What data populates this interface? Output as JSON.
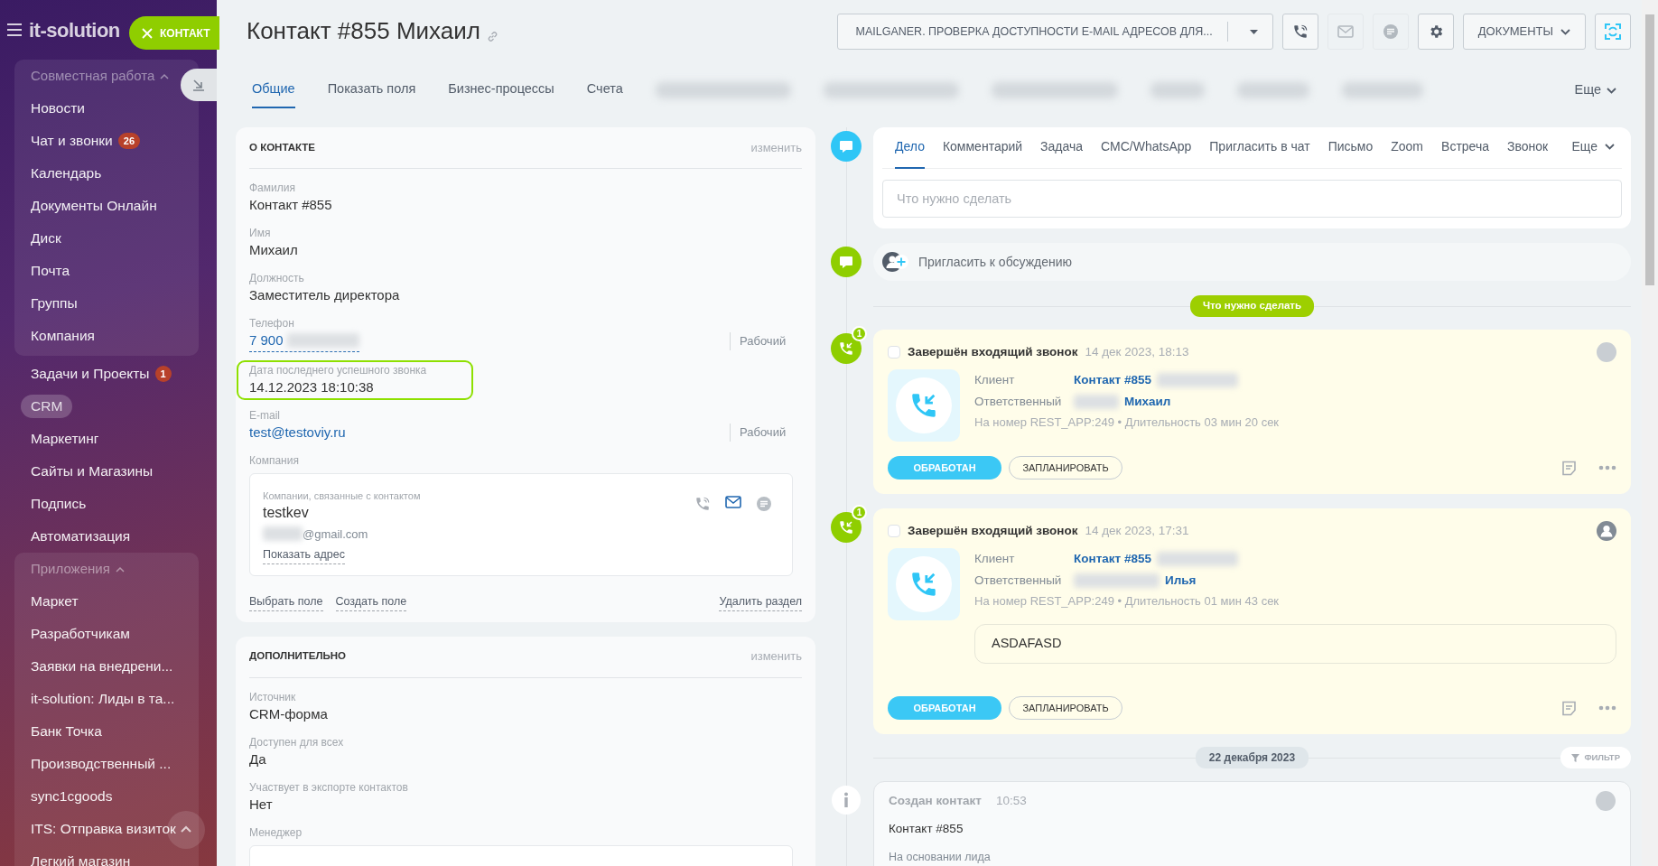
{
  "slider_label": "КОНТАКТ",
  "sidebar": {
    "logo": "it-solution",
    "entries": [
      {
        "kind": "group",
        "title": "Совместная работа",
        "expanded": true,
        "children": [
          {
            "label": "Новости",
            "selected": false
          },
          {
            "label": "Чат и звонки",
            "badge": "26",
            "selected": false
          },
          {
            "label": "Календарь",
            "selected": false
          },
          {
            "label": "Документы Онлайн",
            "selected": false
          },
          {
            "label": "Диск",
            "selected": false
          },
          {
            "label": "Почта",
            "selected": false
          },
          {
            "label": "Группы",
            "selected": false
          },
          {
            "label": "Компания",
            "selected": false
          }
        ]
      },
      {
        "kind": "item",
        "label": "Задачи и Проекты",
        "badge": "1",
        "selected": false
      },
      {
        "kind": "item",
        "label": "CRM",
        "selected": true
      },
      {
        "kind": "item",
        "label": "Маркетинг",
        "selected": false
      },
      {
        "kind": "item",
        "label": "Сайты и Магазины",
        "selected": false
      },
      {
        "kind": "item",
        "label": "Подпись",
        "selected": false
      },
      {
        "kind": "item",
        "label": "Автоматизация",
        "selected": false
      },
      {
        "kind": "group",
        "title": "Приложения",
        "expanded": true,
        "children": [
          {
            "label": "Маркет",
            "selected": false
          },
          {
            "label": "Разработчикам",
            "selected": false
          },
          {
            "label": "Заявки на внедрени...",
            "selected": false
          },
          {
            "label": "it-solution: Лиды в та...",
            "selected": false
          },
          {
            "label": "Банк Точка",
            "selected": false
          },
          {
            "label": "Производственный ...",
            "selected": false
          },
          {
            "label": "sync1cgoods",
            "selected": false
          },
          {
            "label": "ITS: Отправка визиток",
            "selected": false
          },
          {
            "label": "Легкий магазин",
            "selected": false
          }
        ]
      }
    ]
  },
  "header": {
    "title": "Контакт #855 Михаил",
    "app_button": "MAILGANER. ПРОВЕРКА ДОСТУПНОСТИ E-MAIL АДРЕСОВ ДЛЯ...",
    "toolbar": [
      {
        "kind": "phone",
        "disabled": false
      },
      {
        "kind": "mail",
        "disabled": true
      },
      {
        "kind": "chat",
        "disabled": true
      },
      {
        "kind": "settings",
        "disabled": false
      },
      {
        "kind": "menu",
        "label": "ДОКУМЕНТЫ",
        "disabled": false
      },
      {
        "kind": "sync",
        "disabled": false
      }
    ]
  },
  "tabs": [
    {
      "label": "Общие",
      "selected": true
    },
    {
      "label": "Показать поля",
      "selected": false
    },
    {
      "label": "Бизнес-процессы",
      "selected": false
    },
    {
      "label": "Счета",
      "selected": false
    }
  ],
  "tabs_more": "Еще",
  "sections": [
    {
      "title": "О КОНТАКТЕ",
      "action": "изменить",
      "fields": [
        {
          "kind": "text",
          "label": "Фамилия",
          "value": "Контакт #855",
          "highlighted": false
        },
        {
          "kind": "text",
          "label": "Имя",
          "value": "Михаил",
          "highlighted": false
        },
        {
          "kind": "text",
          "label": "Должность",
          "value": "Заместитель директора",
          "highlighted": false
        },
        {
          "kind": "phone",
          "label": "Телефон",
          "value": "7 900",
          "type": "Рабочий",
          "highlighted": false
        },
        {
          "kind": "text",
          "label": "Дата последнего успешного звонка",
          "value": "14.12.2023 18:10:38",
          "highlighted": true
        },
        {
          "kind": "email",
          "label": "E-mail",
          "value": "test@testoviy.ru",
          "type": "Рабочий",
          "highlighted": false
        },
        {
          "kind": "company",
          "label": "Компания",
          "sublabel": "Компании, связанные с контактом",
          "value": "testkev",
          "email": "@gmail.com",
          "link": "Показать адрес",
          "highlighted": false
        }
      ],
      "footer_links": [
        "Выбрать поле",
        "Создать поле"
      ],
      "footer_action": "Удалить раздел"
    },
    {
      "title": "ДОПОЛНИТЕЛЬНО",
      "action": "изменить",
      "fields": [
        {
          "kind": "text",
          "label": "Источник",
          "value": "CRM-форма",
          "highlighted": false
        },
        {
          "kind": "text",
          "label": "Доступен для всех",
          "value": "Да",
          "highlighted": false
        },
        {
          "kind": "text",
          "label": "Участвует в экспорте контактов",
          "value": "Нет",
          "highlighted": false
        },
        {
          "kind": "empty",
          "label": "Менеджер",
          "highlighted": false
        }
      ]
    }
  ],
  "timeline": {
    "composer": {
      "tabs": [
        {
          "label": "Дело",
          "selected": true
        },
        {
          "label": "Комментарий",
          "selected": false
        },
        {
          "label": "Задача",
          "selected": false
        },
        {
          "label": "СМС/WhatsApp",
          "selected": false
        },
        {
          "label": "Пригласить в чат",
          "selected": false
        },
        {
          "label": "Письмо",
          "selected": false
        },
        {
          "label": "Zoom",
          "selected": false
        },
        {
          "label": "Встреча",
          "selected": false
        },
        {
          "label": "Звонок",
          "selected": false
        }
      ],
      "more": "Еще",
      "placeholder": "Что нужно сделать"
    },
    "invite": "Пригласить к обсуждению",
    "todo_label": "Что нужно сделать",
    "calls": [
      {
        "counter": "1",
        "checked": false,
        "title": "Завершён входящий звонок",
        "time": "14 дек 2023, 18:13",
        "avatar": {
          "kind": "photo"
        },
        "client_label": "Клиент",
        "client": "Контакт #855",
        "responsible_label": "Ответственный",
        "responsible": "Михаил",
        "details": "На номер REST_APP:249 • Длительность 03 мин 20 сек",
        "buttons": [
          "ОБРАБОТАН",
          "ЗАПЛАНИРОВАТЬ"
        ]
      },
      {
        "counter": "1",
        "checked": false,
        "title": "Завершён входящий звонок",
        "time": "14 дек 2023, 17:31",
        "avatar": {
          "kind": "generic"
        },
        "client_label": "Клиент",
        "client": "Контакт #855",
        "responsible_label": "Ответственный",
        "responsible": "Илья",
        "details": "На номер REST_APP:249 • Длительность 01 мин 43 сек",
        "comment": "ASDAFASD",
        "buttons": [
          "ОБРАБОТАН",
          "ЗАПЛАНИРОВАТЬ"
        ]
      }
    ],
    "date": "22 декабря 2023",
    "filter": "ФИЛЬТР",
    "history": [
      {
        "title": "Создан контакт",
        "time": "10:53",
        "avatar": {
          "kind": "photo"
        },
        "text": "Контакт #855",
        "note": "На основании лида"
      }
    ]
  }
}
